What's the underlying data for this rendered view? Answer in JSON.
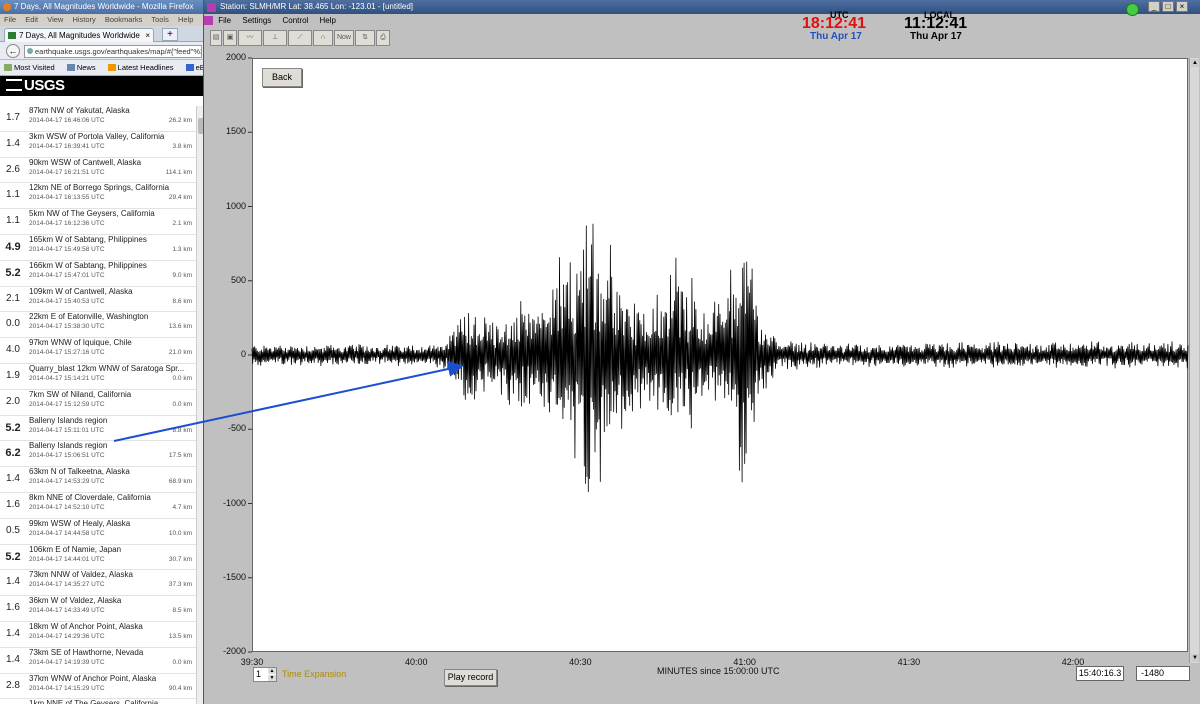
{
  "firefox": {
    "window_title": "7 Days, All Magnitudes Worldwide - Mozilla Firefox",
    "menu": [
      "File",
      "Edit",
      "View",
      "History",
      "Bookmarks",
      "Tools",
      "Help"
    ],
    "tab_title": "7 Days, All Magnitudes Worldwide",
    "url": "earthquake.usgs.gov/earthquakes/map/#{\"feed\"%3A",
    "bookmarks": [
      "Most Visited",
      "News",
      "Latest Headlines",
      "eBay"
    ],
    "usgs_logo": "USGS",
    "earthquakes": [
      {
        "mag": "1.7",
        "place": "87km NW of Yakutat, Alaska",
        "time": "2014-04-17 16:46:06 UTC",
        "depth": "26.2 km",
        "big": false
      },
      {
        "mag": "1.4",
        "place": "3km WSW of Portola Valley, California",
        "time": "2014-04-17 16:39:41 UTC",
        "depth": "3.8 km",
        "big": false
      },
      {
        "mag": "2.6",
        "place": "90km WSW of Cantwell, Alaska",
        "time": "2014-04-17 16:21:51 UTC",
        "depth": "114.1 km",
        "big": false
      },
      {
        "mag": "1.1",
        "place": "12km NE of Borrego Springs, California",
        "time": "2014-04-17 16:13:55 UTC",
        "depth": "29.4 km",
        "big": false
      },
      {
        "mag": "1.1",
        "place": "5km NW of The Geysers, California",
        "time": "2014-04-17 16:12:36 UTC",
        "depth": "2.1 km",
        "big": false
      },
      {
        "mag": "4.9",
        "place": "165km W of Sabtang, Philippines",
        "time": "2014-04-17 15:49:58 UTC",
        "depth": "1.3 km",
        "big": true
      },
      {
        "mag": "5.2",
        "place": "166km W of Sabtang, Philippines",
        "time": "2014-04-17 15:47:01 UTC",
        "depth": "9.0 km",
        "big": true
      },
      {
        "mag": "2.1",
        "place": "109km W of Cantwell, Alaska",
        "time": "2014-04-17 15:40:53 UTC",
        "depth": "8.6 km",
        "big": false
      },
      {
        "mag": "0.0",
        "place": "22km E of Eatonville, Washington",
        "time": "2014-04-17 15:38:30 UTC",
        "depth": "13.6 km",
        "big": false
      },
      {
        "mag": "4.0",
        "place": "97km WNW of Iquique, Chile",
        "time": "2014-04-17 15:27:16 UTC",
        "depth": "21.0 km",
        "big": false
      },
      {
        "mag": "1.9",
        "place": "Quarry_blast 12km WNW of Saratoga Spr...",
        "time": "2014-04-17 15:14:21 UTC",
        "depth": "0.0 km",
        "big": false
      },
      {
        "mag": "2.0",
        "place": "7km SW of Niland, California",
        "time": "2014-04-17 15:12:59 UTC",
        "depth": "0.0 km",
        "big": false
      },
      {
        "mag": "5.2",
        "place": "Balleny Islands region",
        "time": "2014-04-17 15:11:01 UTC",
        "depth": "8.8 km",
        "big": true
      },
      {
        "mag": "6.2",
        "place": "Balleny Islands region",
        "time": "2014-04-17 15:06:51 UTC",
        "depth": "17.5 km",
        "big": true
      },
      {
        "mag": "1.4",
        "place": "63km N of Talkeetna, Alaska",
        "time": "2014-04-17 14:53:29 UTC",
        "depth": "68.9 km",
        "big": false
      },
      {
        "mag": "1.6",
        "place": "8km NNE of Cloverdale, California",
        "time": "2014-04-17 14:52:10 UTC",
        "depth": "4.7 km",
        "big": false
      },
      {
        "mag": "0.5",
        "place": "99km WSW of Healy, Alaska",
        "time": "2014-04-17 14:44:58 UTC",
        "depth": "10.0 km",
        "big": false
      },
      {
        "mag": "5.2",
        "place": "106km E of Namie, Japan",
        "time": "2014-04-17 14:44:01 UTC",
        "depth": "30.7 km",
        "big": true
      },
      {
        "mag": "1.4",
        "place": "73km NNW of Valdez, Alaska",
        "time": "2014-04-17 14:35:27 UTC",
        "depth": "37.3 km",
        "big": false
      },
      {
        "mag": "1.6",
        "place": "36km W of Valdez, Alaska",
        "time": "2014-04-17 14:33:49 UTC",
        "depth": "8.5 km",
        "big": false
      },
      {
        "mag": "1.4",
        "place": "18km W of Anchor Point, Alaska",
        "time": "2014-04-17 14:29:36 UTC",
        "depth": "13.5 km",
        "big": false
      },
      {
        "mag": "1.4",
        "place": "73km SE of Hawthorne, Nevada",
        "time": "2014-04-17 14:19:39 UTC",
        "depth": "0.0 km",
        "big": false
      },
      {
        "mag": "2.8",
        "place": "37km WNW of Anchor Point, Alaska",
        "time": "2014-04-17 14:15:29 UTC",
        "depth": "90.4 km",
        "big": false
      },
      {
        "mag": "",
        "place": "1km NNE of The Geysers, California",
        "time": "",
        "depth": "",
        "big": false
      }
    ]
  },
  "seismo": {
    "window_title": "Station: SLMH/MR Lat: 38.465 Lon: -123.01 - [untitled]",
    "menu": [
      "File",
      "Settings",
      "Control",
      "Help"
    ],
    "toolbar_now": "Now",
    "utc_label": "UTC",
    "utc_time": "18:12:41",
    "utc_date": "Thu Apr 17",
    "local_label": "LOCAL",
    "local_time": "11:12:41",
    "local_date": "Thu Apr 17",
    "back_label": "Back",
    "play_label": "Play record",
    "time_expansion_value": "1",
    "time_expansion_label": "Time Expansion",
    "x_axis_title": "MINUTES since 15:00:00 UTC",
    "cursor_time": "15:40:16.3",
    "cursor_value": "-1480"
  },
  "chart_data": {
    "type": "line",
    "title": "",
    "xlabel": "MINUTES since 15:00:00 UTC",
    "ylabel": "",
    "ylim": [
      -2000,
      2000
    ],
    "xlim": [
      39.5,
      42.35
    ],
    "y_ticks": [
      "2000",
      "1500",
      "1000",
      "500",
      "0",
      "-500",
      "-1000",
      "-1500",
      "-2000"
    ],
    "x_ticks": [
      "39:30",
      "40:00",
      "40:30",
      "41:00",
      "41:30",
      "42:00"
    ],
    "series": [
      {
        "color": "#000000",
        "description_points_x": [
          39.5,
          40.05,
          40.1,
          40.15,
          40.25,
          40.4,
          40.5,
          40.52,
          40.55,
          40.6,
          40.7,
          40.75,
          40.8,
          40.88,
          40.95,
          41.0,
          41.05,
          41.1,
          41.3,
          41.6,
          42.0,
          42.35
        ],
        "description_points_amp": [
          80,
          80,
          120,
          350,
          300,
          450,
          800,
          1200,
          900,
          600,
          300,
          500,
          600,
          300,
          450,
          1100,
          300,
          120,
          80,
          90,
          100,
          100
        ]
      }
    ]
  }
}
